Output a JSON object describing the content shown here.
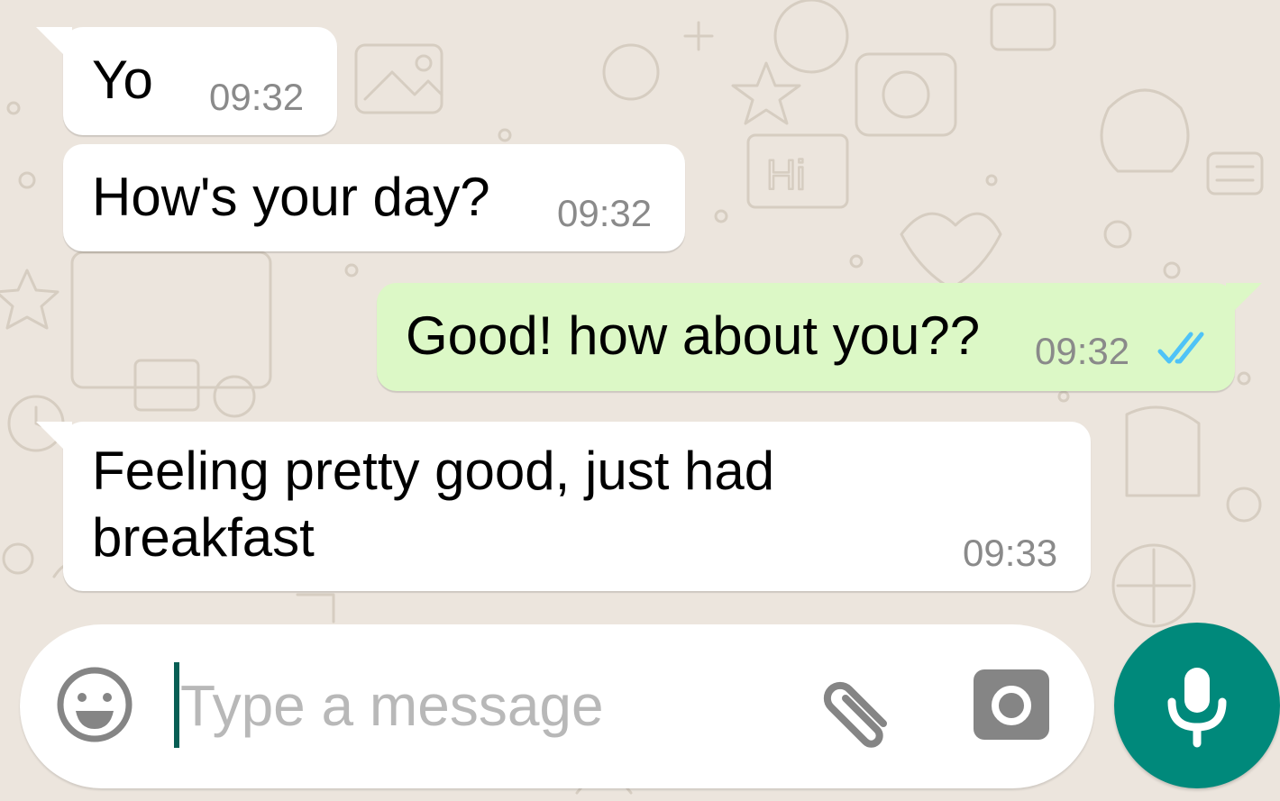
{
  "colors": {
    "background": "#ece5dd",
    "incoming_bubble": "#ffffff",
    "outgoing_bubble": "#dcf8c6",
    "timestamp": "#8a8a8a",
    "read_ticks": "#4fc3f7",
    "accent": "#00897b"
  },
  "messages": [
    {
      "direction": "incoming",
      "text": "Yo",
      "time": "09:32"
    },
    {
      "direction": "incoming",
      "text": "How's your day?",
      "time": "09:32"
    },
    {
      "direction": "outgoing",
      "text": "Good! how about you??",
      "time": "09:32",
      "status": "read",
      "status_icon": "double-check-icon"
    },
    {
      "direction": "incoming",
      "lines": [
        "Feeling pretty good, just had",
        "breakfast"
      ],
      "time": "09:33"
    }
  ],
  "composer": {
    "placeholder": "Type a message",
    "value": "",
    "emoji_icon": "smiley-icon",
    "attach_icon": "paperclip-icon",
    "camera_icon": "camera-icon",
    "send_icon": "microphone-icon"
  }
}
